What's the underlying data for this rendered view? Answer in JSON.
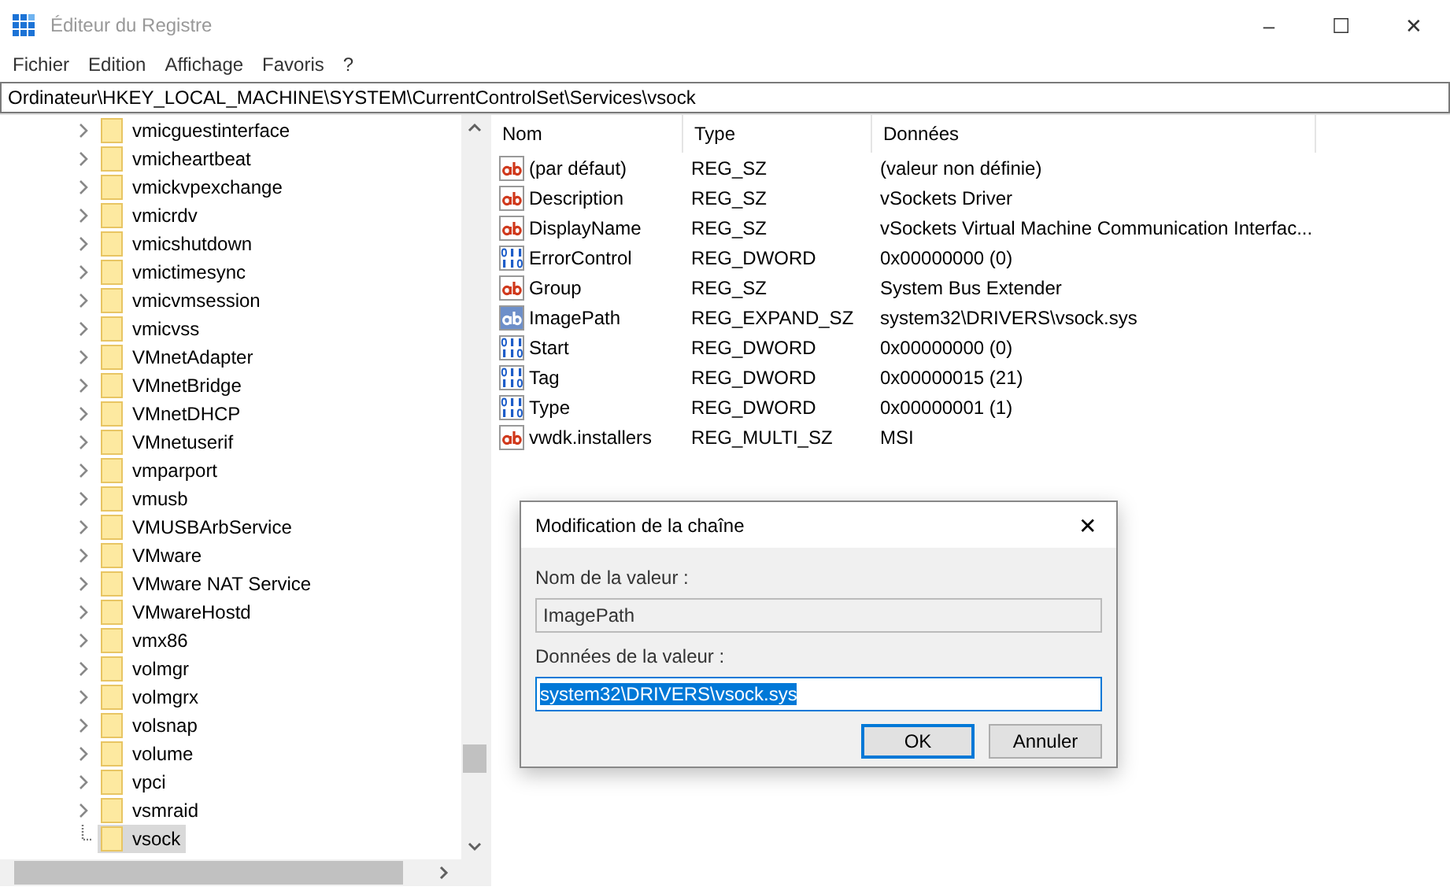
{
  "window": {
    "title": "Éditeur du Registre",
    "controls": [
      "–",
      "☐",
      "✕"
    ]
  },
  "menu": [
    "Fichier",
    "Edition",
    "Affichage",
    "Favoris",
    "?"
  ],
  "address": "Ordinateur\\HKEY_LOCAL_MACHINE\\SYSTEM\\CurrentControlSet\\Services\\vsock",
  "tree": {
    "items": [
      {
        "label": "vmicguestinterface",
        "expandable": true,
        "selected": false
      },
      {
        "label": "vmicheartbeat",
        "expandable": true,
        "selected": false
      },
      {
        "label": "vmickvpexchange",
        "expandable": true,
        "selected": false
      },
      {
        "label": "vmicrdv",
        "expandable": true,
        "selected": false
      },
      {
        "label": "vmicshutdown",
        "expandable": true,
        "selected": false
      },
      {
        "label": "vmictimesync",
        "expandable": true,
        "selected": false
      },
      {
        "label": "vmicvmsession",
        "expandable": true,
        "selected": false
      },
      {
        "label": "vmicvss",
        "expandable": true,
        "selected": false
      },
      {
        "label": "VMnetAdapter",
        "expandable": true,
        "selected": false
      },
      {
        "label": "VMnetBridge",
        "expandable": true,
        "selected": false
      },
      {
        "label": "VMnetDHCP",
        "expandable": true,
        "selected": false
      },
      {
        "label": "VMnetuserif",
        "expandable": true,
        "selected": false
      },
      {
        "label": "vmparport",
        "expandable": true,
        "selected": false
      },
      {
        "label": "vmusb",
        "expandable": true,
        "selected": false
      },
      {
        "label": "VMUSBArbService",
        "expandable": true,
        "selected": false
      },
      {
        "label": "VMware",
        "expandable": true,
        "selected": false
      },
      {
        "label": "VMware NAT Service",
        "expandable": true,
        "selected": false
      },
      {
        "label": "VMwareHostd",
        "expandable": true,
        "selected": false
      },
      {
        "label": "vmx86",
        "expandable": true,
        "selected": false
      },
      {
        "label": "volmgr",
        "expandable": true,
        "selected": false
      },
      {
        "label": "volmgrx",
        "expandable": true,
        "selected": false
      },
      {
        "label": "volsnap",
        "expandable": true,
        "selected": false
      },
      {
        "label": "volume",
        "expandable": true,
        "selected": false
      },
      {
        "label": "vpci",
        "expandable": true,
        "selected": false
      },
      {
        "label": "vsmraid",
        "expandable": true,
        "selected": false
      },
      {
        "label": "vsock",
        "expandable": false,
        "selected": true
      }
    ]
  },
  "values": {
    "columns": [
      "Nom",
      "Type",
      "Données"
    ],
    "rows": [
      {
        "kind": "string",
        "name": "(par défaut)",
        "type": "REG_SZ",
        "data": "(valeur non définie)",
        "selected": false
      },
      {
        "kind": "string",
        "name": "Description",
        "type": "REG_SZ",
        "data": "vSockets Driver",
        "selected": false
      },
      {
        "kind": "string",
        "name": "DisplayName",
        "type": "REG_SZ",
        "data": "vSockets Virtual Machine Communication Interfac...",
        "selected": false
      },
      {
        "kind": "binary",
        "name": "ErrorControl",
        "type": "REG_DWORD",
        "data": "0x00000000 (0)",
        "selected": false
      },
      {
        "kind": "string",
        "name": "Group",
        "type": "REG_SZ",
        "data": "System Bus Extender",
        "selected": false
      },
      {
        "kind": "string",
        "name": "ImagePath",
        "type": "REG_EXPAND_SZ",
        "data": "system32\\DRIVERS\\vsock.sys",
        "selected": true
      },
      {
        "kind": "binary",
        "name": "Start",
        "type": "REG_DWORD",
        "data": "0x00000000 (0)",
        "selected": false
      },
      {
        "kind": "binary",
        "name": "Tag",
        "type": "REG_DWORD",
        "data": "0x00000015 (21)",
        "selected": false
      },
      {
        "kind": "binary",
        "name": "Type",
        "type": "REG_DWORD",
        "data": "0x00000001 (1)",
        "selected": false
      },
      {
        "kind": "string",
        "name": "vwdk.installers",
        "type": "REG_MULTI_SZ",
        "data": "MSI",
        "selected": false
      }
    ]
  },
  "dialog": {
    "title": "Modification de la chaîne",
    "close": "✕",
    "name_label": "Nom de la valeur :",
    "name_value": "ImagePath",
    "data_label": "Données de la valeur :",
    "data_value": "system32\\DRIVERS\\vsock.sys",
    "buttons": [
      "OK",
      "Annuler"
    ]
  }
}
